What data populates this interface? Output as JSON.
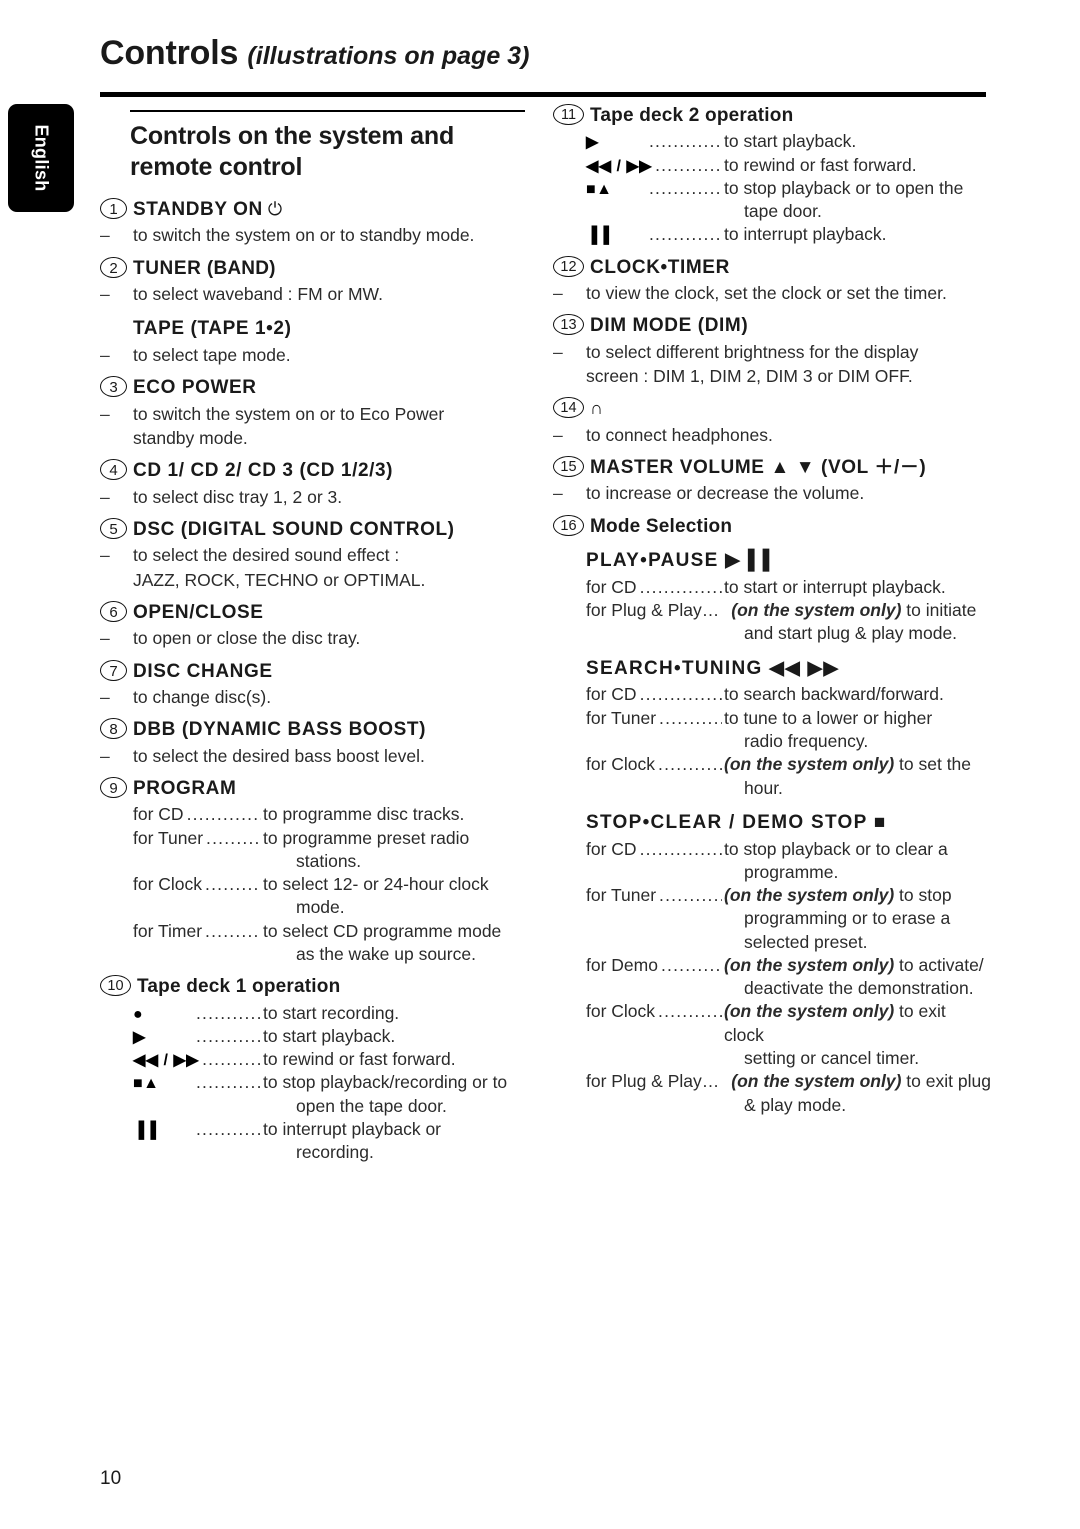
{
  "language_tab": "English",
  "page_header": {
    "title_main": "Controls",
    "title_sub": "(illustrations on page 3)"
  },
  "page_number": "10",
  "left_column": {
    "section_title": "Controls on the system and remote control",
    "entries": [
      {
        "number": "1",
        "heading": "STANDBY ON",
        "symbol": "⏻",
        "symbol_name": "power-standby-icon",
        "lines": [
          {
            "dash": "–",
            "text": "to switch the system on or to standby mode."
          }
        ]
      },
      {
        "number": "2",
        "heading": "TUNER",
        "heading_paren": "(BAND)",
        "lines": [
          {
            "dash": "–",
            "text": "to select waveband : FM or MW."
          }
        ],
        "sub_heading": "TAPE (TAPE 1•2)",
        "sub_lines": [
          {
            "dash": "–",
            "text": "to select tape mode."
          }
        ]
      },
      {
        "number": "3",
        "heading": "ECO POWER",
        "lines": [
          {
            "dash": "–",
            "text": "to switch the system on or to Eco Power"
          },
          {
            "cont": "standby mode."
          }
        ]
      },
      {
        "number": "4",
        "heading": "CD 1/ CD 2/ CD 3 (CD 1/2/3)",
        "lines": [
          {
            "dash": "–",
            "text": "to select disc tray 1, 2 or 3."
          }
        ]
      },
      {
        "number": "5",
        "heading": "DSC (DIGITAL SOUND CONTROL)",
        "lines": [
          {
            "dash": "–",
            "text": "to select the desired sound effect :"
          },
          {
            "cont": "JAZZ, ROCK, TECHNO or OPTIMAL."
          }
        ]
      },
      {
        "number": "6",
        "heading": "OPEN/CLOSE",
        "lines": [
          {
            "dash": "–",
            "text": "to open or close the disc tray."
          }
        ]
      },
      {
        "number": "7",
        "heading": "DISC CHANGE",
        "lines": [
          {
            "dash": "–",
            "text": "to change disc(s)."
          }
        ]
      },
      {
        "number": "8",
        "heading": "DBB (DYNAMIC BASS BOOST)",
        "lines": [
          {
            "dash": "–",
            "text": "to select the desired bass boost level."
          }
        ]
      },
      {
        "number": "9",
        "heading": "PROGRAM",
        "leader_rows": [
          {
            "label": "for CD",
            "desc": "to programme disc tracks."
          },
          {
            "label": "for Tuner",
            "desc": "to programme preset radio",
            "cont": "stations."
          },
          {
            "label": "for Clock",
            "desc": "to select 12- or 24-hour clock",
            "cont": "mode."
          },
          {
            "label": "for Timer",
            "desc": "to select CD programme mode",
            "cont": "as the wake up source."
          }
        ]
      },
      {
        "number": "10",
        "heading": "Tape deck 1 operation",
        "heading_style": "mixed",
        "symbol_rows": [
          {
            "symbol": "●",
            "symbol_name": "record-icon",
            "desc": "to start recording."
          },
          {
            "symbol": "▶",
            "symbol_name": "play-icon",
            "desc": "to start playback."
          },
          {
            "symbol": "◀◀ / ▶▶",
            "symbol_name": "rewind-fastforward-icon",
            "desc": "to rewind or fast forward."
          },
          {
            "symbol": "■▲",
            "symbol_name": "stop-eject-icon",
            "desc": "to stop playback/recording or to",
            "cont": "open the tape door."
          },
          {
            "symbol": "▐▐",
            "symbol_name": "pause-icon",
            "desc": "to interrupt playback or",
            "cont": "recording."
          }
        ]
      }
    ]
  },
  "right_column": {
    "entries": [
      {
        "number": "11",
        "heading": "Tape deck 2 operation",
        "heading_style": "mixed",
        "symbol_rows": [
          {
            "symbol": "▶",
            "symbol_name": "play-icon",
            "desc": "to start playback."
          },
          {
            "symbol": "◀◀ / ▶▶",
            "symbol_name": "rewind-fastforward-icon",
            "desc": "to rewind or fast forward."
          },
          {
            "symbol": "■▲",
            "symbol_name": "stop-eject-icon",
            "desc": "to stop playback or to open the",
            "cont": "tape door."
          },
          {
            "symbol": "▐▐",
            "symbol_name": "pause-icon",
            "desc": "to interrupt playback."
          }
        ]
      },
      {
        "number": "12",
        "heading": "CLOCK•TIMER",
        "lines": [
          {
            "dash": "–",
            "text": "to view the clock, set the clock or set the timer."
          }
        ]
      },
      {
        "number": "13",
        "heading": "DIM MODE (DIM)",
        "lines": [
          {
            "dash": "–",
            "text": "to select different brightness for the display"
          },
          {
            "cont": "screen : DIM 1, DIM 2, DIM 3 or DIM OFF."
          }
        ]
      },
      {
        "number": "14",
        "heading": "",
        "symbol": "∩",
        "symbol_name": "headphones-icon",
        "lines": [
          {
            "dash": "–",
            "text": "to connect headphones."
          }
        ]
      },
      {
        "number": "15",
        "heading": "MASTER VOLUME ▲ ▼ (VOL ＋/－)",
        "lines": [
          {
            "dash": "–",
            "text": "to increase or decrease the volume."
          }
        ]
      },
      {
        "number": "16",
        "heading": "Mode Selection",
        "heading_style": "mixed",
        "sub_blocks": [
          {
            "sub_heading": "PLAY•PAUSE ▶▐▐",
            "leader_rows": [
              {
                "label": "for CD",
                "desc": "to start or interrupt playback."
              },
              {
                "label": "for Plug & Play…",
                "desc_italic": "(on the system only)",
                "desc": " to initiate",
                "cont": "and start plug & play mode.",
                "nodots": true
              }
            ]
          },
          {
            "sub_heading": "SEARCH•TUNING ◀◀  ▶▶",
            "leader_rows": [
              {
                "label": "for CD",
                "desc": "to search backward/forward."
              },
              {
                "label": "for Tuner",
                "desc": "to tune to a lower or higher",
                "cont": "radio frequency."
              },
              {
                "label": "for Clock",
                "desc_italic": "(on the system only)",
                "desc": " to set the",
                "cont": "hour."
              }
            ]
          },
          {
            "sub_heading": "STOP•CLEAR / DEMO STOP ■",
            "leader_rows": [
              {
                "label": "for CD",
                "desc": "to stop playback or to clear a",
                "cont": "programme."
              },
              {
                "label": "for Tuner",
                "desc_italic": "(on the system only)",
                "desc": " to stop",
                "cont": "programming or to erase a",
                "cont2": "selected preset."
              },
              {
                "label": "for Demo",
                "desc_italic": "(on the system only)",
                "desc": " to activate/",
                "cont": "deactivate the demonstration."
              },
              {
                "label": "for Clock",
                "desc_italic": "(on the system only)",
                "desc": " to exit clock",
                "cont": "setting or cancel timer."
              },
              {
                "label": "for Plug & Play…",
                "desc_italic": "(on the system only)",
                "desc": " to exit plug",
                "cont": "& play mode.",
                "nodots": true
              }
            ]
          }
        ]
      }
    ]
  }
}
